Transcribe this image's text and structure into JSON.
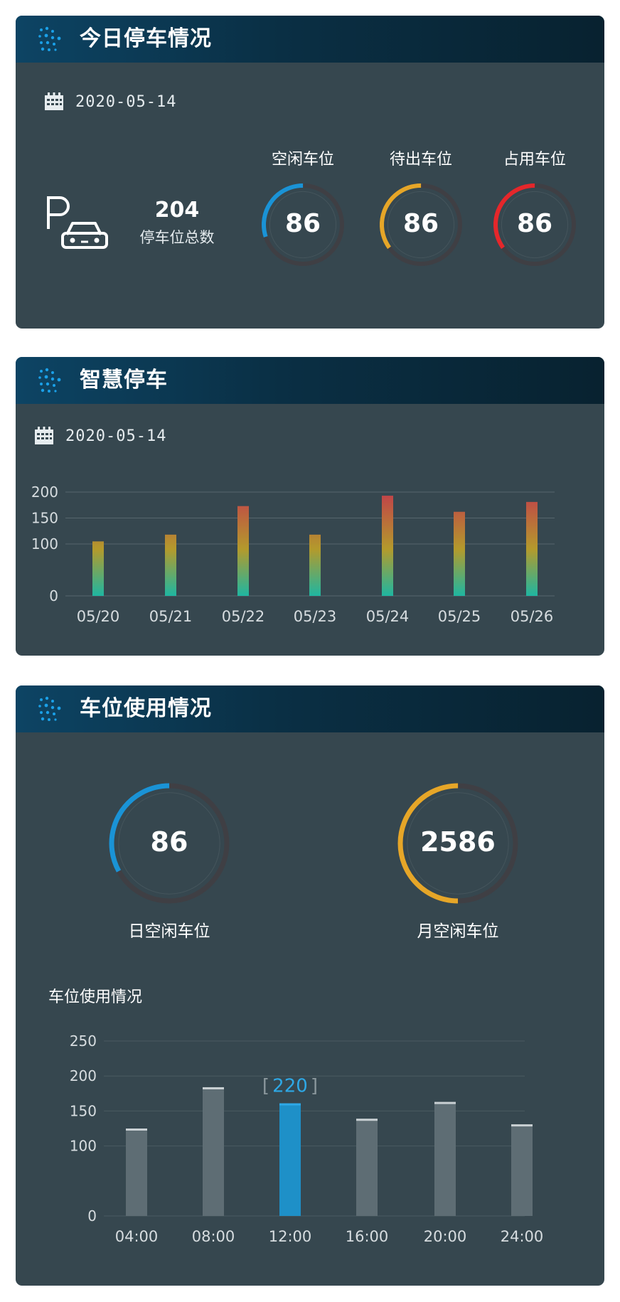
{
  "today": {
    "title": "今日停车情况",
    "date": "2020-05-14",
    "total": {
      "value": "204",
      "label": "停车位总数"
    },
    "rings": [
      {
        "label": "空闲车位",
        "value": "86",
        "fraction": 0.3,
        "color": "#1a93d6"
      },
      {
        "label": "待出车位",
        "value": "86",
        "fraction": 0.35,
        "color": "#e6a628"
      },
      {
        "label": "占用车位",
        "value": "86",
        "fraction": 0.35,
        "color": "#e5272b"
      }
    ]
  },
  "smart": {
    "title": "智慧停车",
    "date": "2020-05-14"
  },
  "usage": {
    "title": "车位使用情况",
    "chart_title": "车位使用情况",
    "rings": [
      {
        "label": "日空闲车位",
        "value": "86",
        "fraction": 0.33,
        "color": "#1a93d6"
      },
      {
        "label": "月空闲车位",
        "value": "2586",
        "fraction": 0.5,
        "color": "#e6a628"
      }
    ],
    "highlight_label": "[ 220 ]",
    "highlight_value": "220"
  },
  "colors": {
    "panel": "#36474f",
    "grid": "#56666d",
    "highlight": "#1e90c8",
    "bar_gray": "#5e6d74"
  },
  "chart_data": [
    {
      "type": "bar",
      "categories": [
        "05/20",
        "05/21",
        "05/22",
        "05/23",
        "05/24",
        "05/25",
        "05/26"
      ],
      "values": [
        105,
        118,
        173,
        118,
        193,
        162,
        181
      ],
      "ylim": [
        0,
        200
      ],
      "yticks": [
        0,
        100,
        150,
        200
      ],
      "grid": true
    },
    {
      "type": "bar",
      "categories": [
        "04:00",
        "08:00",
        "12:00",
        "16:00",
        "20:00",
        "24:00"
      ],
      "values": [
        125,
        184,
        161,
        139,
        163,
        131
      ],
      "ylim": [
        0,
        250
      ],
      "yticks": [
        0,
        100,
        150,
        200,
        250
      ],
      "highlight_index": 2,
      "grid": true
    }
  ]
}
